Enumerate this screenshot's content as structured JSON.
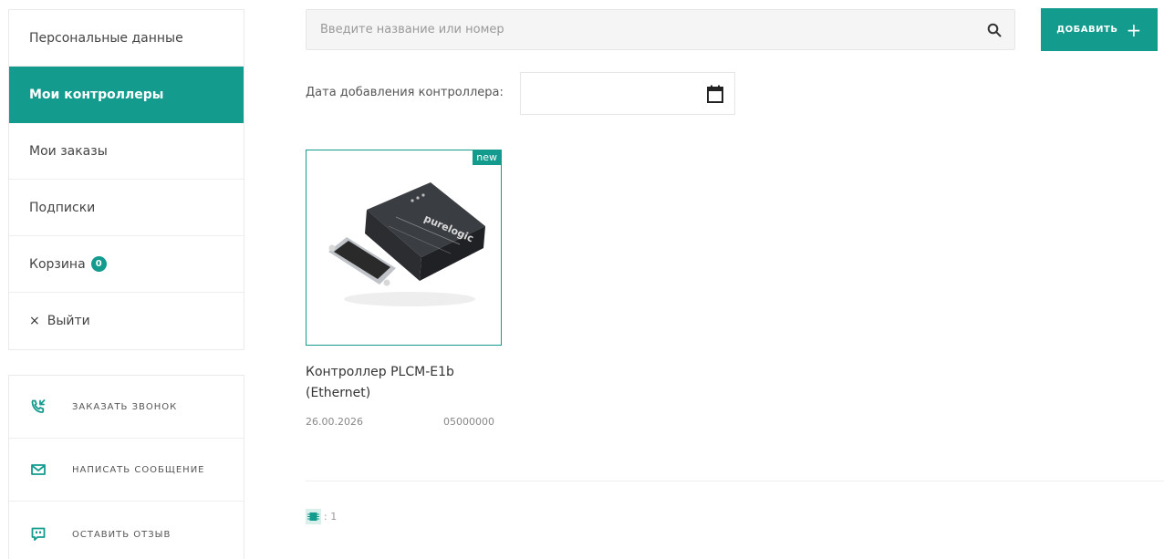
{
  "sidebar": {
    "items": [
      {
        "label": "Персональные данные"
      },
      {
        "label": "Мои контроллеры"
      },
      {
        "label": "Мои заказы"
      },
      {
        "label": "Подписки"
      },
      {
        "label": "Корзина",
        "badge": "0"
      },
      {
        "label": "Выйти",
        "prefix": "×"
      }
    ]
  },
  "contact": {
    "items": [
      {
        "label": "ЗАКАЗАТЬ ЗВОНОК",
        "icon": "phone-icon"
      },
      {
        "label": "НАПИСАТЬ СООБЩЕНИЕ",
        "icon": "envelope-icon"
      },
      {
        "label": "ОСТАВИТЬ ОТЗЫВ",
        "icon": "chat-quote-icon"
      }
    ]
  },
  "search": {
    "placeholder": "Введите название или номер",
    "value": ""
  },
  "add_button": {
    "label": "ДОБАВИТЬ",
    "icon": "+"
  },
  "filter": {
    "date_label": "Дата добавления контроллера:"
  },
  "products": [
    {
      "badge": "new",
      "title": "Контроллер PLCM-E1b (Ethernet)",
      "date": "26.00.2026",
      "number": "05000000",
      "image_text": "purelogic"
    }
  ],
  "count": {
    "text": ": 1"
  },
  "colors": {
    "accent": "#139b8e",
    "search_bg": "#f5f5f5"
  }
}
